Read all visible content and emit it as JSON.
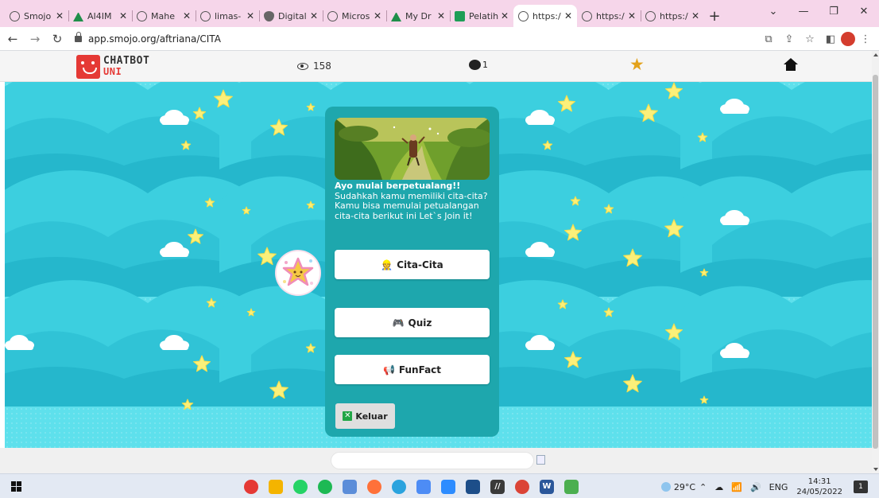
{
  "browser": {
    "tabs": [
      {
        "label": "Smojo",
        "icon": "globe-icon"
      },
      {
        "label": "AI4IM",
        "icon": "google-drive-icon"
      },
      {
        "label": "Mahe",
        "icon": "globe-icon"
      },
      {
        "label": "limas-",
        "icon": "globe-icon"
      },
      {
        "label": "Digital",
        "icon": "shield-icon"
      },
      {
        "label": "Micros",
        "icon": "globe-icon"
      },
      {
        "label": "My Dr",
        "icon": "google-drive-icon"
      },
      {
        "label": "Pelatih",
        "icon": "google-sheets-icon"
      },
      {
        "label": "https:/",
        "icon": "globe-icon",
        "active": true
      },
      {
        "label": "https:/",
        "icon": "globe-icon"
      },
      {
        "label": "https:/",
        "icon": "globe-icon"
      }
    ],
    "new_tab": "+",
    "url": "app.smojo.org/aftriana/CITA"
  },
  "app": {
    "logo_line1": "CHATBOT",
    "logo_line2": "UNI",
    "views_count": "158",
    "comments_count": "1"
  },
  "chat": {
    "heading": "Ayo mulai berpetualang!!",
    "body": "Sudahkah kamu memiliki cita-cita? Kamu bisa memulai petualangan cita-cita berikut ini Let`s Join it!",
    "buttons": [
      {
        "emoji": "👷",
        "label": "Cita-Cita"
      },
      {
        "emoji": "🎮",
        "label": "Quiz"
      },
      {
        "emoji": "📢",
        "label": "FunFact"
      }
    ],
    "exit_label": "Keluar",
    "exit_glyph": "✕",
    "input_placeholder": ""
  },
  "taskbar": {
    "temperature": "29°C",
    "language": "ENG",
    "time": "14:31",
    "date": "24/05/2022",
    "notification_count": "1",
    "apps": [
      {
        "name": "opera-icon",
        "color": "#e53935",
        "glyph": ""
      },
      {
        "name": "file-explorer-icon",
        "color": "#f4b400",
        "glyph": ""
      },
      {
        "name": "whatsapp-icon",
        "color": "#25d366",
        "glyph": ""
      },
      {
        "name": "spotify-icon",
        "color": "#1db954",
        "glyph": ""
      },
      {
        "name": "photos-icon",
        "color": "#5b8dd9",
        "glyph": ""
      },
      {
        "name": "firefox-icon",
        "color": "#ff7139",
        "glyph": ""
      },
      {
        "name": "telegram-icon",
        "color": "#2aa3de",
        "glyph": ""
      },
      {
        "name": "zoom-chat-icon",
        "color": "#4d8cf5",
        "glyph": ""
      },
      {
        "name": "zoom-icon",
        "color": "#2d8cff",
        "glyph": ""
      },
      {
        "name": "meet-icon",
        "color": "#1d4e89",
        "glyph": ""
      },
      {
        "name": "notes-icon",
        "color": "#3a3a3a",
        "glyph": "//"
      },
      {
        "name": "chrome-icon",
        "color": "#db4437",
        "glyph": ""
      },
      {
        "name": "word-icon",
        "color": "#2b579a",
        "glyph": "W"
      },
      {
        "name": "paint-icon",
        "color": "#4caf50",
        "glyph": ""
      }
    ]
  }
}
